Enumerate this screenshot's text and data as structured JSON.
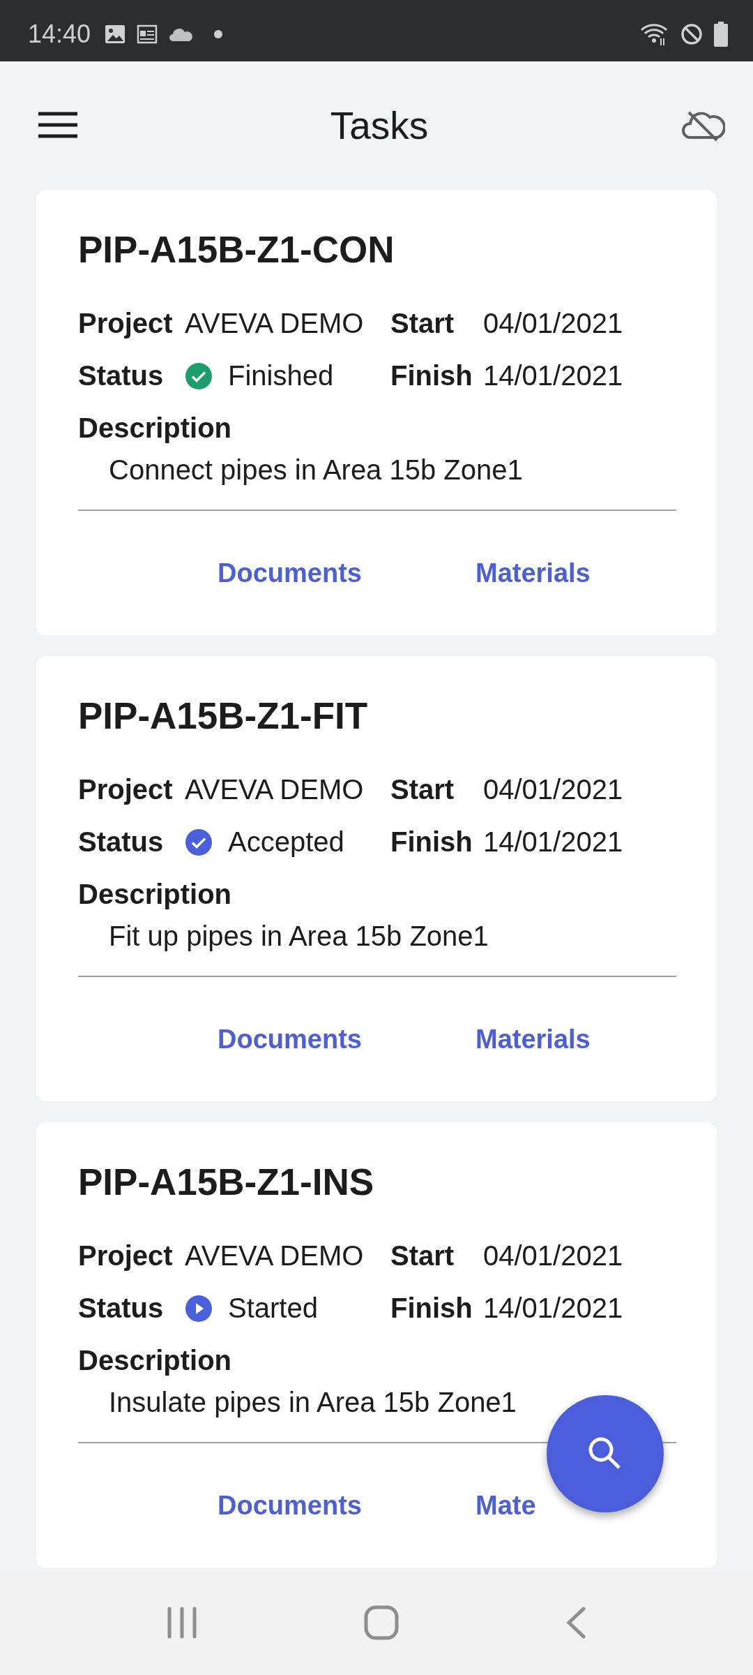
{
  "status_bar": {
    "time": "14:40"
  },
  "app_bar": {
    "title": "Tasks"
  },
  "tasks": [
    {
      "title": "PIP-A15B-Z1-CON",
      "project_label": "Project",
      "project": "AVEVA DEMO",
      "start_label": "Start",
      "start": "04/01/2021",
      "status_label": "Status",
      "status": {
        "kind": "check",
        "color": "#1a9e6e",
        "text": "Finished"
      },
      "finish_label": "Finish",
      "finish": "14/01/2021",
      "description_label": "Description",
      "description": "Connect pipes in Area 15b Zone1",
      "actions": [
        "Documents",
        "Materials"
      ]
    },
    {
      "title": "PIP-A15B-Z1-FIT",
      "project_label": "Project",
      "project": "AVEVA DEMO",
      "start_label": "Start",
      "start": "04/01/2021",
      "status_label": "Status",
      "status": {
        "kind": "check",
        "color": "#4a5fdc",
        "text": "Accepted"
      },
      "finish_label": "Finish",
      "finish": "14/01/2021",
      "description_label": "Description",
      "description": "Fit up pipes in Area 15b Zone1",
      "actions": [
        "Documents",
        "Materials"
      ]
    },
    {
      "title": "PIP-A15B-Z1-INS",
      "project_label": "Project",
      "project": "AVEVA DEMO",
      "start_label": "Start",
      "start": "04/01/2021",
      "status_label": "Status",
      "status": {
        "kind": "play",
        "color": "#4a5fdc",
        "text": "Started"
      },
      "finish_label": "Finish",
      "finish": "14/01/2021",
      "description_label": "Description",
      "description": "Insulate pipes in Area 15b Zone1",
      "actions": [
        "Documents",
        "Mate"
      ]
    }
  ]
}
